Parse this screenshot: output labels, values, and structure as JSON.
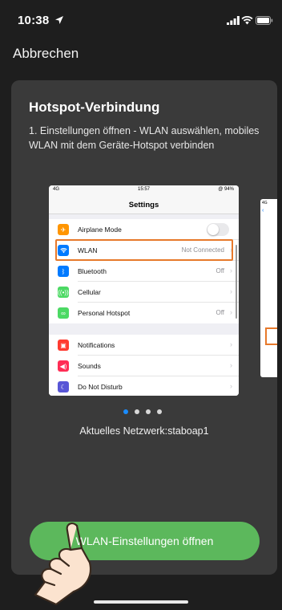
{
  "status_bar": {
    "time": "10:38"
  },
  "header": {
    "cancel_label": "Abbrechen"
  },
  "card": {
    "title": "Hotspot-Verbindung",
    "description": "1. Einstellungen öffnen - WLAN auswählen, mobiles WLAN mit dem Geräte-Hotspot verbinden"
  },
  "illustration": {
    "status_left": "4G",
    "status_time": "15:57",
    "status_right": "@ 94%",
    "nav_title": "Settings",
    "rows": [
      {
        "label": "Airplane Mode",
        "value": "",
        "icon": "airplane-icon",
        "color": "#ff9500"
      },
      {
        "label": "WLAN",
        "value": "Not Connected",
        "icon": "wifi-icon",
        "color": "#007aff"
      },
      {
        "label": "Bluetooth",
        "value": "Off",
        "icon": "bluetooth-icon",
        "color": "#007aff"
      },
      {
        "label": "Cellular",
        "value": "",
        "icon": "cellular-icon",
        "color": "#4cd964"
      },
      {
        "label": "Personal Hotspot",
        "value": "Off",
        "icon": "hotspot-icon",
        "color": "#4cd964"
      },
      {
        "label": "Notifications",
        "value": "",
        "icon": "notifications-icon",
        "color": "#ff3b30"
      },
      {
        "label": "Sounds",
        "value": "",
        "icon": "sounds-icon",
        "color": "#ff2d55"
      },
      {
        "label": "Do Not Disturb",
        "value": "",
        "icon": "moon-icon",
        "color": "#5856d6"
      }
    ],
    "highlight_color": "#e7792b"
  },
  "carousel": {
    "page_count": 4,
    "active_index": 0,
    "active_color": "#1a8cff"
  },
  "network_label": "Aktuelles Netzwerk:staboap1",
  "action_button_label": "WLAN-Einstellungen öffnen",
  "colors": {
    "accent_green": "#5cb85c",
    "background": "#1e1e1e",
    "card": "#3a3a3a"
  }
}
